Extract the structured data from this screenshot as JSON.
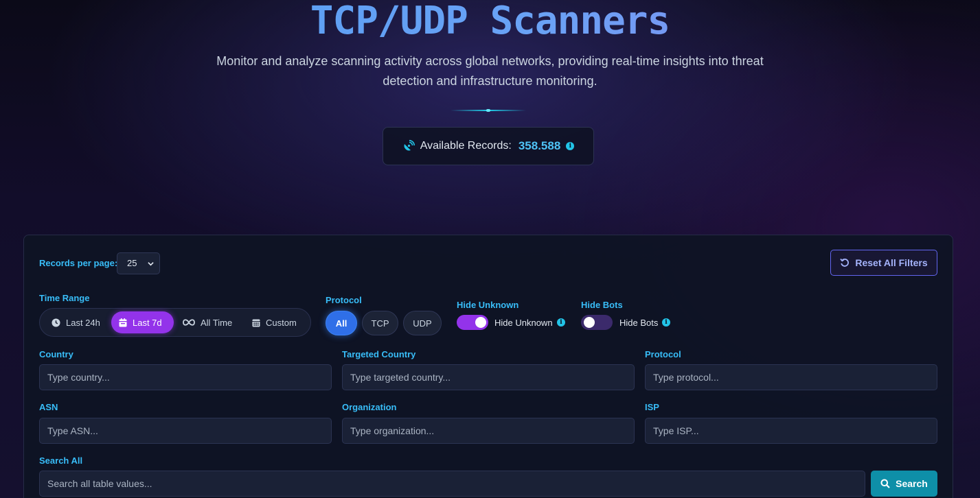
{
  "hero": {
    "title": "TCP/UDP Scanners",
    "subtitle": "Monitor and analyze scanning activity across global networks, providing real-time insights into threat detection and infrastructure monitoring."
  },
  "records": {
    "label": "Available Records:",
    "value": "358.588",
    "icon": "satellite-dish-icon"
  },
  "filters": {
    "records_per_page_label": "Records per page:",
    "records_per_page_value": "25",
    "reset_label": "Reset All Filters",
    "time_range_label": "Time Range",
    "time_options": [
      {
        "label": "Last 24h",
        "icon": "clock-icon",
        "active": false
      },
      {
        "label": "Last 7d",
        "icon": "calendar-icon",
        "active": true
      },
      {
        "label": "All Time",
        "icon": "infinity-icon",
        "active": false
      },
      {
        "label": "Custom",
        "icon": "calendar-grid-icon",
        "active": false
      }
    ],
    "protocol_label": "Protocol",
    "protocol_options": [
      {
        "label": "All",
        "active": true
      },
      {
        "label": "TCP",
        "active": false
      },
      {
        "label": "UDP",
        "active": false
      }
    ],
    "hide_unknown": {
      "label": "Hide Unknown",
      "toggle_text": "Hide Unknown",
      "on": true
    },
    "hide_bots": {
      "label": "Hide Bots",
      "toggle_text": "Hide Bots",
      "on": false
    }
  },
  "fields": {
    "country": {
      "label": "Country",
      "placeholder": "Type country..."
    },
    "targeted_country": {
      "label": "Targeted Country",
      "placeholder": "Type targeted country..."
    },
    "protocol": {
      "label": "Protocol",
      "placeholder": "Type protocol..."
    },
    "asn": {
      "label": "ASN",
      "placeholder": "Type ASN..."
    },
    "organization": {
      "label": "Organization",
      "placeholder": "Type organization..."
    },
    "isp": {
      "label": "ISP",
      "placeholder": "Type ISP..."
    },
    "search_all": {
      "label": "Search All",
      "placeholder": "Search all table values..."
    }
  },
  "search_button": {
    "label": "Search"
  },
  "colors": {
    "accent_cyan": "#38bdf8",
    "accent_purple": "#9333ea",
    "accent_blue": "#2f6fe8",
    "search_teal": "#0e8fa8"
  }
}
